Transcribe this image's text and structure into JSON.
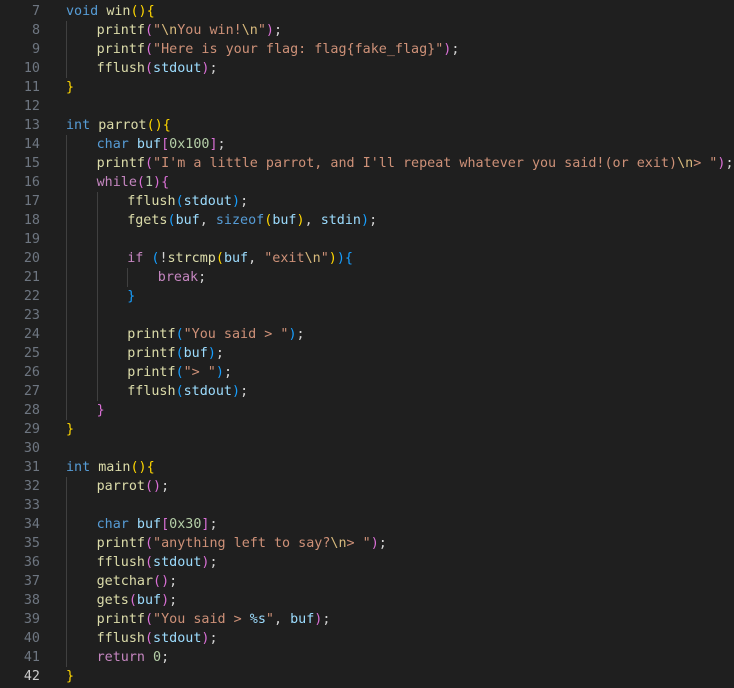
{
  "editor": {
    "active_line": 42,
    "colors": {
      "background": "#1f1f1f",
      "line_number": "#6e7681",
      "line_number_active": "#cccccc",
      "keyword": "#569cd6",
      "control": "#c586c0",
      "function": "#dcdcaa",
      "string": "#ce9178",
      "escape": "#d7ba7d",
      "number": "#b5cea8",
      "variable": "#9cdcfe",
      "bracket_1": "#ffd700",
      "bracket_2": "#da70d6",
      "bracket_3": "#179fff"
    },
    "lines": [
      {
        "n": 7,
        "indent": 0,
        "tokens": [
          [
            "kw",
            "void"
          ],
          [
            "txt",
            " "
          ],
          [
            "fn",
            "win"
          ],
          [
            "b1",
            "()"
          ],
          [
            "b1",
            "{"
          ]
        ]
      },
      {
        "n": 8,
        "indent": 1,
        "tokens": [
          [
            "fn",
            "printf"
          ],
          [
            "b2",
            "("
          ],
          [
            "str",
            "\""
          ],
          [
            "esc",
            "\\n"
          ],
          [
            "str",
            "You win!"
          ],
          [
            "esc",
            "\\n"
          ],
          [
            "str",
            "\""
          ],
          [
            "b2",
            ")"
          ],
          [
            "txt",
            ";"
          ]
        ]
      },
      {
        "n": 9,
        "indent": 1,
        "tokens": [
          [
            "fn",
            "printf"
          ],
          [
            "b2",
            "("
          ],
          [
            "str",
            "\"Here is your flag: flag{fake_flag}\""
          ],
          [
            "b2",
            ")"
          ],
          [
            "txt",
            ";"
          ]
        ]
      },
      {
        "n": 10,
        "indent": 1,
        "tokens": [
          [
            "fn",
            "fflush"
          ],
          [
            "b2",
            "("
          ],
          [
            "var",
            "stdout"
          ],
          [
            "b2",
            ")"
          ],
          [
            "txt",
            ";"
          ]
        ]
      },
      {
        "n": 11,
        "indent": 0,
        "tokens": [
          [
            "b1",
            "}"
          ]
        ]
      },
      {
        "n": 12,
        "indent": 0,
        "tokens": []
      },
      {
        "n": 13,
        "indent": 0,
        "tokens": [
          [
            "kw",
            "int"
          ],
          [
            "txt",
            " "
          ],
          [
            "fn",
            "parrot"
          ],
          [
            "b1",
            "()"
          ],
          [
            "b1",
            "{"
          ]
        ]
      },
      {
        "n": 14,
        "indent": 1,
        "tokens": [
          [
            "kw",
            "char"
          ],
          [
            "txt",
            " "
          ],
          [
            "var",
            "buf"
          ],
          [
            "b2",
            "["
          ],
          [
            "num",
            "0x100"
          ],
          [
            "b2",
            "]"
          ],
          [
            "txt",
            ";"
          ]
        ]
      },
      {
        "n": 15,
        "indent": 1,
        "tokens": [
          [
            "fn",
            "printf"
          ],
          [
            "b2",
            "("
          ],
          [
            "str",
            "\"I'm a little parrot, and I'll repeat whatever you said!(or exit)"
          ],
          [
            "esc",
            "\\n"
          ],
          [
            "str",
            "> \""
          ],
          [
            "b2",
            ")"
          ],
          [
            "txt",
            ";"
          ]
        ]
      },
      {
        "n": 16,
        "indent": 1,
        "tokens": [
          [
            "ctl",
            "while"
          ],
          [
            "b2",
            "("
          ],
          [
            "num",
            "1"
          ],
          [
            "b2",
            ")"
          ],
          [
            "b2",
            "{"
          ]
        ]
      },
      {
        "n": 17,
        "indent": 2,
        "tokens": [
          [
            "fn",
            "fflush"
          ],
          [
            "b3",
            "("
          ],
          [
            "var",
            "stdout"
          ],
          [
            "b3",
            ")"
          ],
          [
            "txt",
            ";"
          ]
        ]
      },
      {
        "n": 18,
        "indent": 2,
        "tokens": [
          [
            "fn",
            "fgets"
          ],
          [
            "b3",
            "("
          ],
          [
            "var",
            "buf"
          ],
          [
            "txt",
            ", "
          ],
          [
            "kw",
            "sizeof"
          ],
          [
            "b1",
            "("
          ],
          [
            "var",
            "buf"
          ],
          [
            "b1",
            ")"
          ],
          [
            "txt",
            ", "
          ],
          [
            "var",
            "stdin"
          ],
          [
            "b3",
            ")"
          ],
          [
            "txt",
            ";"
          ]
        ]
      },
      {
        "n": 19,
        "indent": 2,
        "tokens": []
      },
      {
        "n": 20,
        "indent": 2,
        "tokens": [
          [
            "ctl",
            "if"
          ],
          [
            "txt",
            " "
          ],
          [
            "b3",
            "("
          ],
          [
            "txt",
            "!"
          ],
          [
            "fn",
            "strcmp"
          ],
          [
            "b1",
            "("
          ],
          [
            "var",
            "buf"
          ],
          [
            "txt",
            ", "
          ],
          [
            "str",
            "\"exit"
          ],
          [
            "esc",
            "\\n"
          ],
          [
            "str",
            "\""
          ],
          [
            "b1",
            ")"
          ],
          [
            "b3",
            ")"
          ],
          [
            "b3",
            "{"
          ]
        ]
      },
      {
        "n": 21,
        "indent": 3,
        "tokens": [
          [
            "ctl",
            "break"
          ],
          [
            "txt",
            ";"
          ]
        ]
      },
      {
        "n": 22,
        "indent": 2,
        "tokens": [
          [
            "b3",
            "}"
          ]
        ]
      },
      {
        "n": 23,
        "indent": 2,
        "tokens": []
      },
      {
        "n": 24,
        "indent": 2,
        "tokens": [
          [
            "fn",
            "printf"
          ],
          [
            "b3",
            "("
          ],
          [
            "str",
            "\"You said > \""
          ],
          [
            "b3",
            ")"
          ],
          [
            "txt",
            ";"
          ]
        ]
      },
      {
        "n": 25,
        "indent": 2,
        "tokens": [
          [
            "fn",
            "printf"
          ],
          [
            "b3",
            "("
          ],
          [
            "var",
            "buf"
          ],
          [
            "b3",
            ")"
          ],
          [
            "txt",
            ";"
          ]
        ]
      },
      {
        "n": 26,
        "indent": 2,
        "tokens": [
          [
            "fn",
            "printf"
          ],
          [
            "b3",
            "("
          ],
          [
            "str",
            "\"> \""
          ],
          [
            "b3",
            ")"
          ],
          [
            "txt",
            ";"
          ]
        ]
      },
      {
        "n": 27,
        "indent": 2,
        "tokens": [
          [
            "fn",
            "fflush"
          ],
          [
            "b3",
            "("
          ],
          [
            "var",
            "stdout"
          ],
          [
            "b3",
            ")"
          ],
          [
            "txt",
            ";"
          ]
        ]
      },
      {
        "n": 28,
        "indent": 1,
        "tokens": [
          [
            "b2",
            "}"
          ]
        ]
      },
      {
        "n": 29,
        "indent": 0,
        "tokens": [
          [
            "b1",
            "}"
          ]
        ]
      },
      {
        "n": 30,
        "indent": 0,
        "tokens": []
      },
      {
        "n": 31,
        "indent": 0,
        "tokens": [
          [
            "kw",
            "int"
          ],
          [
            "txt",
            " "
          ],
          [
            "fn",
            "main"
          ],
          [
            "b1",
            "()"
          ],
          [
            "b1",
            "{"
          ]
        ]
      },
      {
        "n": 32,
        "indent": 1,
        "tokens": [
          [
            "fn",
            "parrot"
          ],
          [
            "b2",
            "()"
          ],
          [
            "txt",
            ";"
          ]
        ]
      },
      {
        "n": 33,
        "indent": 1,
        "tokens": []
      },
      {
        "n": 34,
        "indent": 1,
        "tokens": [
          [
            "kw",
            "char"
          ],
          [
            "txt",
            " "
          ],
          [
            "var",
            "buf"
          ],
          [
            "b2",
            "["
          ],
          [
            "num",
            "0x30"
          ],
          [
            "b2",
            "]"
          ],
          [
            "txt",
            ";"
          ]
        ]
      },
      {
        "n": 35,
        "indent": 1,
        "tokens": [
          [
            "fn",
            "printf"
          ],
          [
            "b2",
            "("
          ],
          [
            "str",
            "\"anything left to say?"
          ],
          [
            "esc",
            "\\n"
          ],
          [
            "str",
            "> \""
          ],
          [
            "b2",
            ")"
          ],
          [
            "txt",
            ";"
          ]
        ]
      },
      {
        "n": 36,
        "indent": 1,
        "tokens": [
          [
            "fn",
            "fflush"
          ],
          [
            "b2",
            "("
          ],
          [
            "var",
            "stdout"
          ],
          [
            "b2",
            ")"
          ],
          [
            "txt",
            ";"
          ]
        ]
      },
      {
        "n": 37,
        "indent": 1,
        "tokens": [
          [
            "fn",
            "getchar"
          ],
          [
            "b2",
            "()"
          ],
          [
            "txt",
            ";"
          ]
        ]
      },
      {
        "n": 38,
        "indent": 1,
        "tokens": [
          [
            "fn",
            "gets"
          ],
          [
            "b2",
            "("
          ],
          [
            "var",
            "buf"
          ],
          [
            "b2",
            ")"
          ],
          [
            "txt",
            ";"
          ]
        ]
      },
      {
        "n": 39,
        "indent": 1,
        "tokens": [
          [
            "fn",
            "printf"
          ],
          [
            "b2",
            "("
          ],
          [
            "str",
            "\"You said > "
          ],
          [
            "var",
            "%s"
          ],
          [
            "str",
            "\""
          ],
          [
            "txt",
            ", "
          ],
          [
            "var",
            "buf"
          ],
          [
            "b2",
            ")"
          ],
          [
            "txt",
            ";"
          ]
        ]
      },
      {
        "n": 40,
        "indent": 1,
        "tokens": [
          [
            "fn",
            "fflush"
          ],
          [
            "b2",
            "("
          ],
          [
            "var",
            "stdout"
          ],
          [
            "b2",
            ")"
          ],
          [
            "txt",
            ";"
          ]
        ]
      },
      {
        "n": 41,
        "indent": 1,
        "tokens": [
          [
            "ctl",
            "return"
          ],
          [
            "txt",
            " "
          ],
          [
            "num",
            "0"
          ],
          [
            "txt",
            ";"
          ]
        ]
      },
      {
        "n": 42,
        "indent": 0,
        "tokens": [
          [
            "b1",
            "}"
          ]
        ]
      }
    ]
  }
}
